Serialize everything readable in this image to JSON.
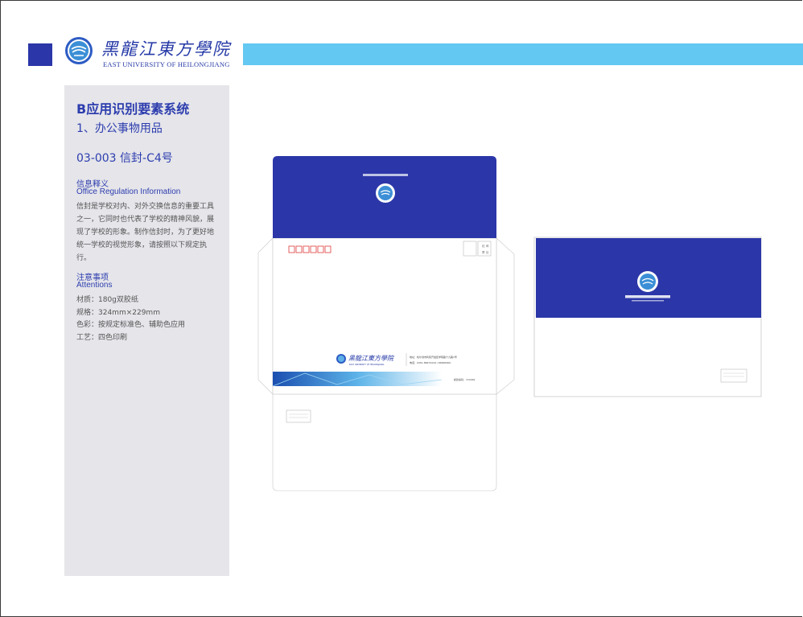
{
  "header": {
    "logo_cn": "黑龍江東方學院",
    "logo_en": "EAST UNIVERSITY OF HEILONGJIANG",
    "colors": {
      "brand_blue": "#2b36a8",
      "bar_cyan": "#63c8f2",
      "panel_gray": "#e5e5ea"
    }
  },
  "panel": {
    "title": "B应用识别要素系统",
    "subtitle": "1、办公事物用品",
    "code": "03-003 信封-C4号",
    "info_cn": "信息释义",
    "info_en": "Office Regulation Information",
    "info_body": "信封是学校对内、对外交换信息的重要工具之一，它同时也代表了学校的精神风貌，展现了学校的形象。制作信封时，为了更好地统一学校的视觉形象，请按照以下规定执行。",
    "attention_cn": "注意事项",
    "attention_en": "Attentions",
    "specs": [
      "材质：180g双胶纸",
      "规格：324mm×229mm",
      "色彩：按规定标准色、辅助色应用",
      "工艺：四色印刷"
    ]
  },
  "envelope": {
    "stamp_label_1": "贴",
    "stamp_label_2": "邮",
    "stamp_label_3": "票",
    "stamp_label_4": "处",
    "footer_logo_cn": "黑龍江東方學院",
    "footer_logo_en": "EAST UNIVERSITY OF HEILONGJIANG",
    "address": "地址：哈尔滨市利民开发区学院路十九路1号",
    "phone": "电话：0451-86672244 / 86665600",
    "postcode": "邮政编码：150066"
  }
}
